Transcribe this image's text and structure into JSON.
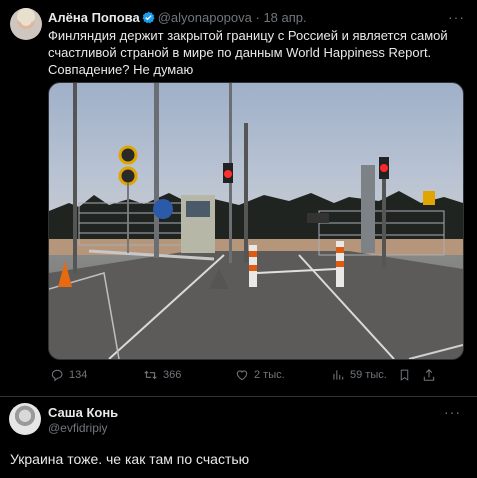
{
  "tweet": {
    "author_name": "Алёна Попова",
    "handle": "@alyonapopova",
    "separator": "·",
    "date": "18 апр.",
    "more_label": "···",
    "text_line1": "Финляндия держит закрытой границу с Россией и является самой",
    "text_line2": "счастливой страной в мире по данным World Happiness Report.",
    "text_line3": "Совпадение? Не думаю",
    "actions": {
      "replies": "134",
      "retweets": "366",
      "likes": "2 тыс.",
      "views": "59 тыс."
    },
    "icons": [
      "verified-badge-icon",
      "reply-icon",
      "retweet-icon",
      "like-icon",
      "views-icon",
      "bookmark-icon",
      "share-icon"
    ],
    "accent_color": "#1d9bf0"
  },
  "reply": {
    "author_name": "Саша Конь",
    "handle": "@evfidripiy",
    "more_label": "···",
    "text": "Украина тоже. че как там по счастью"
  }
}
